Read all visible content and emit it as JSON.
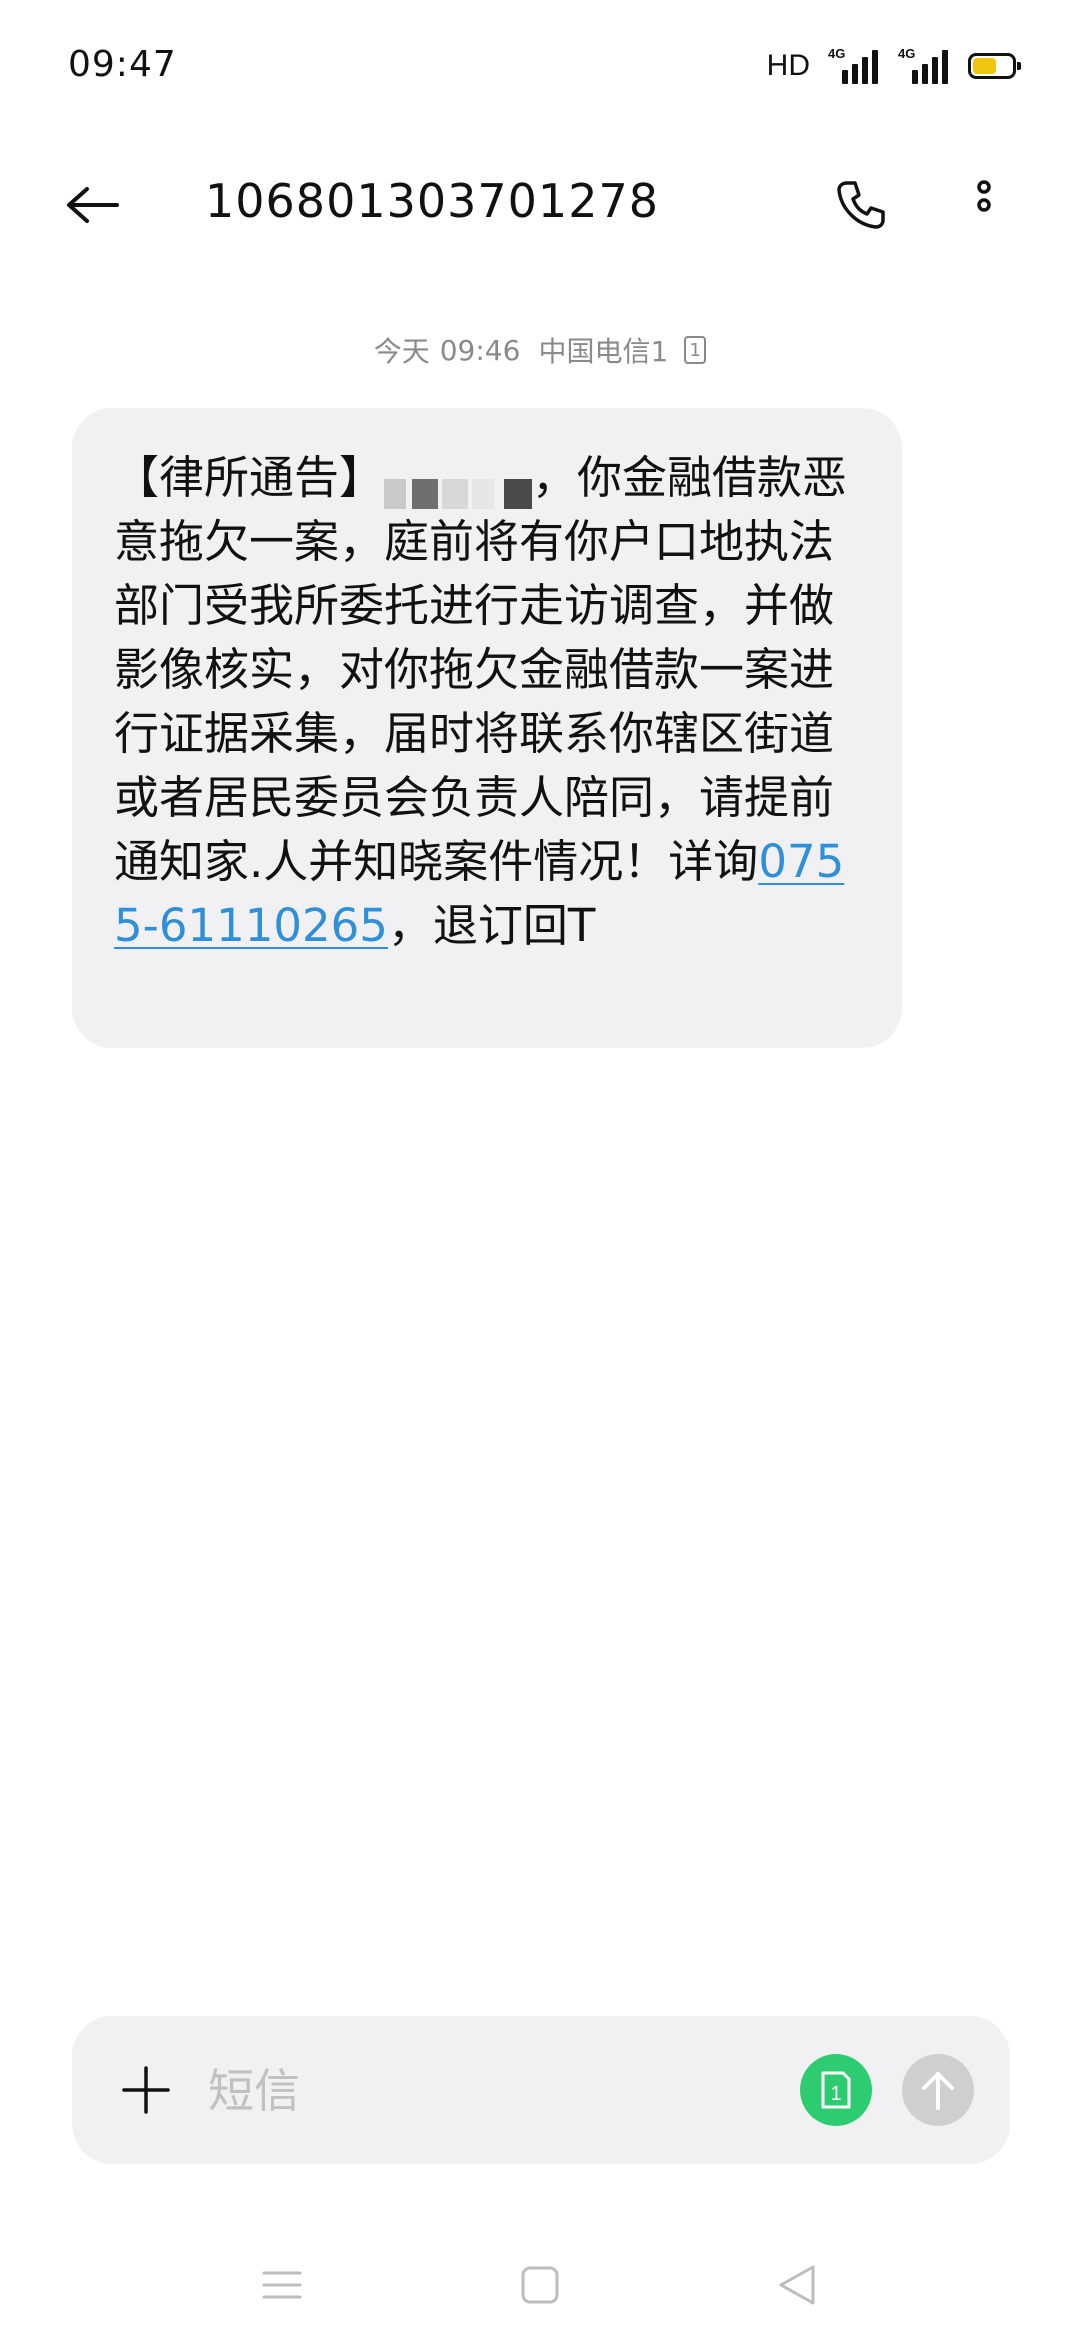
{
  "status_bar": {
    "time": "09:47",
    "hd_label": "HD",
    "signal_1_label": "4G",
    "signal_2_label": "4G",
    "battery_level": 0.6,
    "battery_color": "#f1c40f"
  },
  "header": {
    "contact": "106801303701278",
    "icons": {
      "back": "back-arrow-icon",
      "call": "phone-icon",
      "more": "more-vertical-icon"
    }
  },
  "conversation": {
    "meta": {
      "day": "今天",
      "time": "09:46",
      "carrier": "中国电信1",
      "sim_badge": "1"
    },
    "message": {
      "text_before_redaction": "【律所通告】",
      "text_after_redaction": "，你金融借款恶意拖欠一案，庭前将有你户口地执法部门受我所委托进行走访调查，并做影像核实，对你拖欠金融借款一案进行证据采集，届时将联系你辖区街道或者居民委员会负责人陪同，请提前通知家.人并知晓案件情况！详询",
      "phone_link": "0755-61110265",
      "text_end": "，退订回T",
      "link_color": "#2f8fd8",
      "bubble_color": "#f1f1f3"
    }
  },
  "compose": {
    "placeholder": "短信",
    "value": "",
    "sim_button_label": "1",
    "sim_button_color": "#2ecc71",
    "send_button_color": "#cfcfd1"
  },
  "nav_bar": {
    "icons": [
      "menu-icon",
      "home-square-icon",
      "back-triangle-icon"
    ]
  }
}
